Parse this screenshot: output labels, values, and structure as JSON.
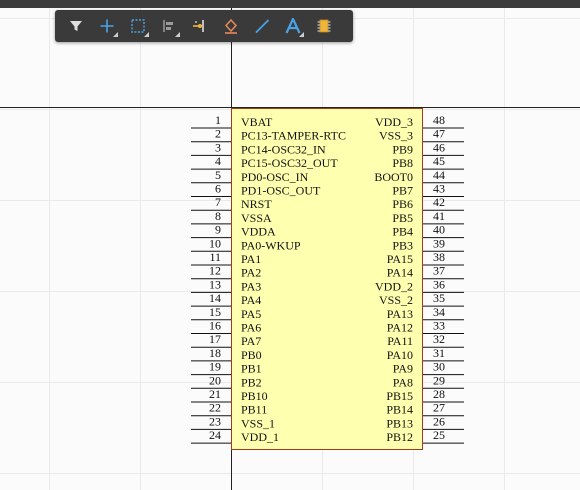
{
  "toolbar": {
    "tools": [
      {
        "name": "filter-icon",
        "has_menu": false
      },
      {
        "name": "crosshair-icon",
        "has_menu": true
      },
      {
        "name": "selection-box-icon",
        "has_menu": true
      },
      {
        "name": "align-icon",
        "has_menu": true
      },
      {
        "name": "place-pin-icon",
        "has_menu": false
      },
      {
        "name": "eraser-fill-icon",
        "has_menu": false
      },
      {
        "name": "line-icon",
        "has_menu": false
      },
      {
        "name": "text-icon",
        "has_menu": true
      },
      {
        "name": "component-icon",
        "has_menu": false
      }
    ]
  },
  "component": {
    "left_pins": [
      {
        "num": "1",
        "label": "VBAT"
      },
      {
        "num": "2",
        "label": "PC13-TAMPER-RTC"
      },
      {
        "num": "3",
        "label": "PC14-OSC32_IN"
      },
      {
        "num": "4",
        "label": "PC15-OSC32_OUT"
      },
      {
        "num": "5",
        "label": "PD0-OSC_IN"
      },
      {
        "num": "6",
        "label": "PD1-OSC_OUT"
      },
      {
        "num": "7",
        "label": "NRST"
      },
      {
        "num": "8",
        "label": "VSSA"
      },
      {
        "num": "9",
        "label": "VDDA"
      },
      {
        "num": "10",
        "label": "PA0-WKUP"
      },
      {
        "num": "11",
        "label": "PA1"
      },
      {
        "num": "12",
        "label": "PA2"
      },
      {
        "num": "13",
        "label": "PA3"
      },
      {
        "num": "14",
        "label": "PA4"
      },
      {
        "num": "15",
        "label": "PA5"
      },
      {
        "num": "16",
        "label": "PA6"
      },
      {
        "num": "17",
        "label": "PA7"
      },
      {
        "num": "18",
        "label": "PB0"
      },
      {
        "num": "19",
        "label": "PB1"
      },
      {
        "num": "20",
        "label": "PB2"
      },
      {
        "num": "21",
        "label": "PB10"
      },
      {
        "num": "22",
        "label": "PB11"
      },
      {
        "num": "23",
        "label": "VSS_1"
      },
      {
        "num": "24",
        "label": "VDD_1"
      }
    ],
    "right_pins": [
      {
        "num": "48",
        "label": "VDD_3"
      },
      {
        "num": "47",
        "label": "VSS_3"
      },
      {
        "num": "46",
        "label": "PB9"
      },
      {
        "num": "45",
        "label": "PB8"
      },
      {
        "num": "44",
        "label": "BOOT0"
      },
      {
        "num": "43",
        "label": "PB7"
      },
      {
        "num": "42",
        "label": "PB6"
      },
      {
        "num": "41",
        "label": "PB5"
      },
      {
        "num": "40",
        "label": "PB4"
      },
      {
        "num": "39",
        "label": "PB3"
      },
      {
        "num": "38",
        "label": "PA15"
      },
      {
        "num": "37",
        "label": "PA14"
      },
      {
        "num": "36",
        "label": "VDD_2"
      },
      {
        "num": "35",
        "label": "VSS_2"
      },
      {
        "num": "34",
        "label": "PA13"
      },
      {
        "num": "33",
        "label": "PA12"
      },
      {
        "num": "32",
        "label": "PA11"
      },
      {
        "num": "31",
        "label": "PA10"
      },
      {
        "num": "30",
        "label": "PA9"
      },
      {
        "num": "29",
        "label": "PA8"
      },
      {
        "num": "28",
        "label": "PB15"
      },
      {
        "num": "27",
        "label": "PB14"
      },
      {
        "num": "26",
        "label": "PB13"
      },
      {
        "num": "25",
        "label": "PB12"
      }
    ]
  },
  "colors": {
    "toolbar_bg": "#3a3a3a",
    "icon_blue": "#4aa3e6",
    "icon_orange": "#e8895a",
    "icon_gold": "#f0b43a",
    "component_fill": "#ffffb0",
    "component_border": "#a33a1a"
  }
}
